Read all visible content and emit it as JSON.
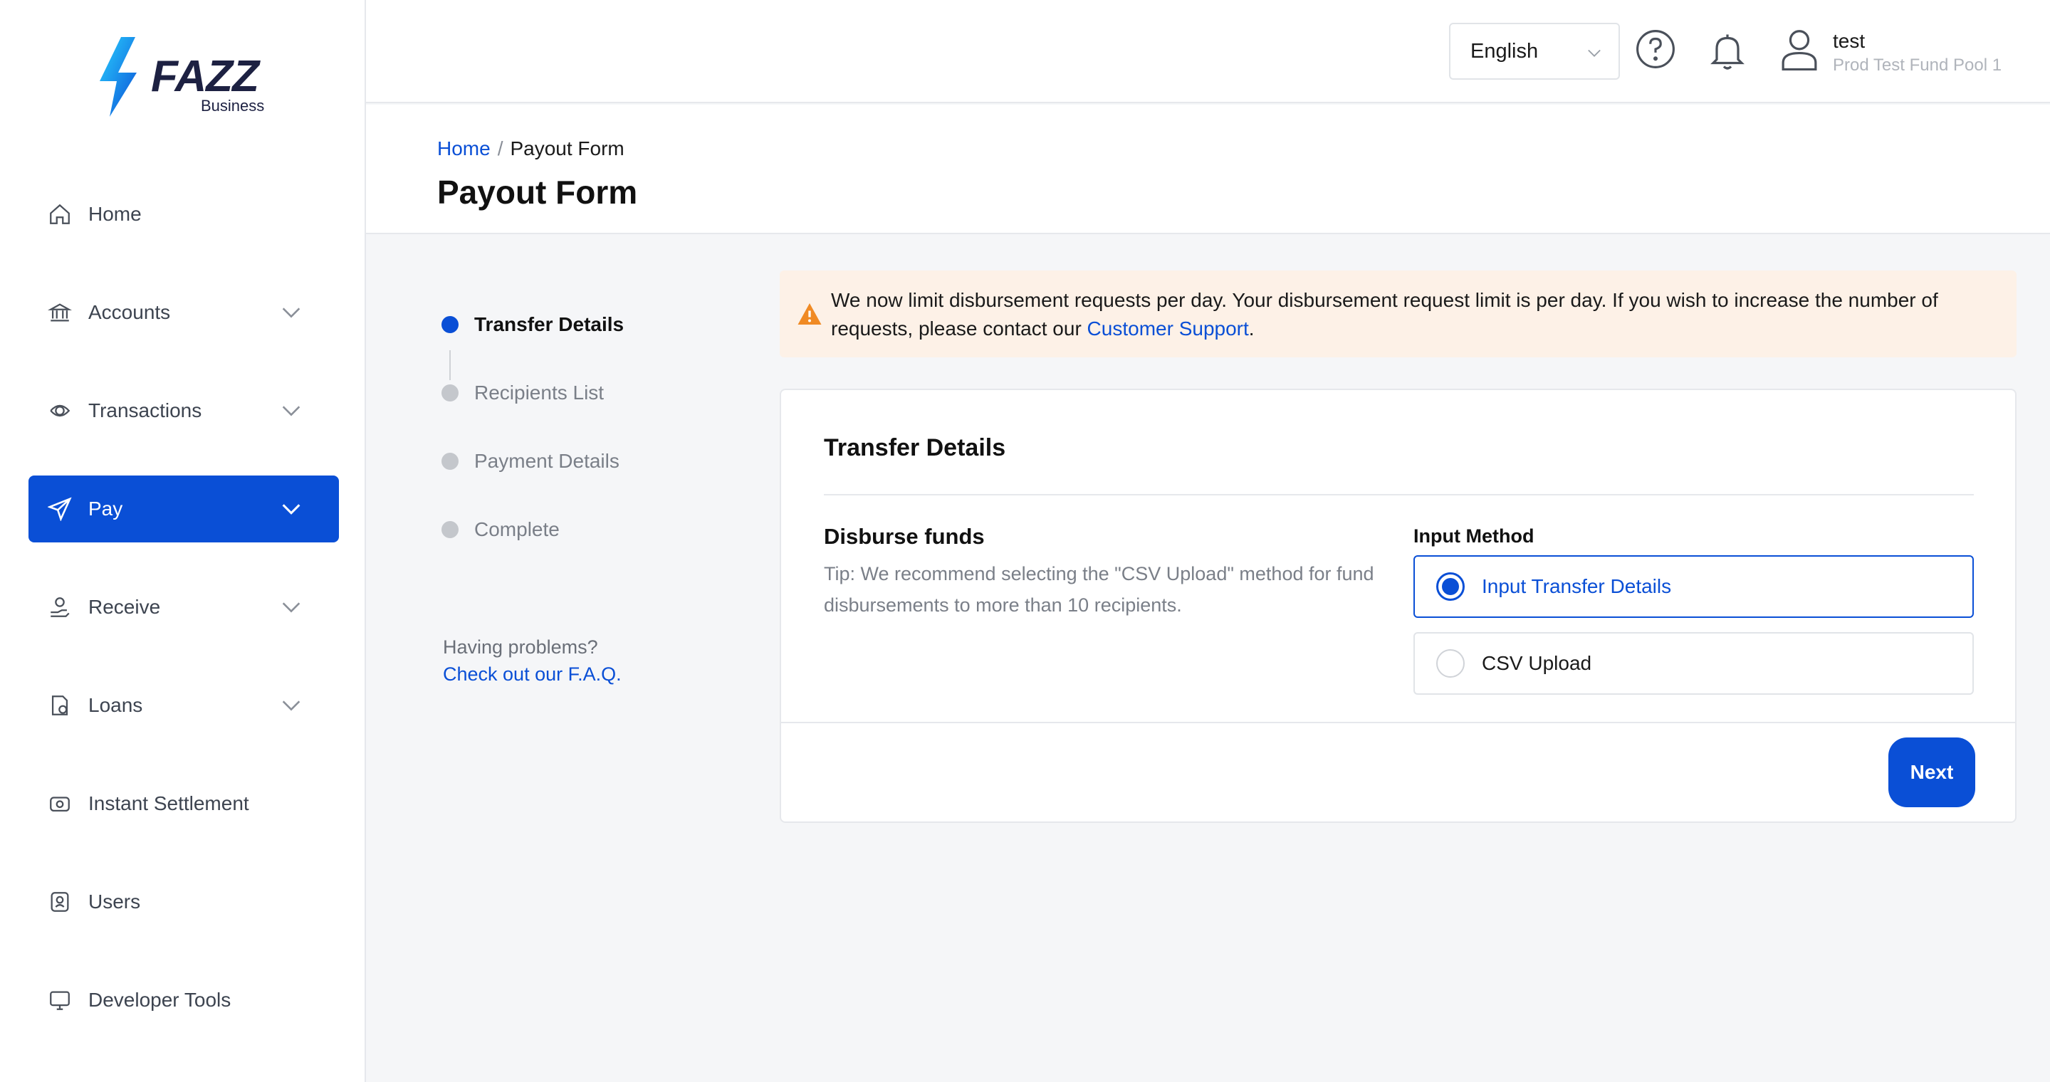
{
  "brand": {
    "name": "FAZZ",
    "sub": "Business",
    "primary": "#0a4fd6"
  },
  "sidebar": {
    "items": [
      {
        "label": "Home",
        "icon": "home-icon",
        "expandable": false
      },
      {
        "label": "Accounts",
        "icon": "bank-icon",
        "expandable": true
      },
      {
        "label": "Transactions",
        "icon": "transactions-icon",
        "expandable": true
      },
      {
        "label": "Pay",
        "icon": "send-icon",
        "expandable": true,
        "active": true
      },
      {
        "label": "Receive",
        "icon": "receive-icon",
        "expandable": true
      },
      {
        "label": "Loans",
        "icon": "loans-icon",
        "expandable": true
      },
      {
        "label": "Instant Settlement",
        "icon": "settlement-icon",
        "expandable": false
      },
      {
        "label": "Users",
        "icon": "users-icon",
        "expandable": false
      },
      {
        "label": "Developer Tools",
        "icon": "monitor-icon",
        "expandable": false
      }
    ]
  },
  "header": {
    "language": "English",
    "user": {
      "name": "test",
      "pool": "Prod Test Fund Pool 1"
    }
  },
  "page": {
    "breadcrumb": {
      "home": "Home",
      "separator": "/",
      "current": "Payout Form"
    },
    "title": "Payout Form"
  },
  "stepper": {
    "steps": [
      "Transfer Details",
      "Recipients List",
      "Payment Details",
      "Complete"
    ],
    "active_index": 0,
    "help_question": "Having problems?",
    "help_link": "Check out our F.A.Q."
  },
  "alert": {
    "text": "We now limit disbursement requests per day. Your disbursement request limit is per day. If you wish to increase the number of requests, please contact our ",
    "link": "Customer Support",
    "suffix": ".",
    "color": "#f08a24"
  },
  "card": {
    "title": "Transfer Details",
    "section_title": "Disburse funds",
    "section_tip": "Tip: We recommend selecting the \"CSV Upload\" method for fund disbursements to more than 10 recipients.",
    "input_method_label": "Input Method",
    "options": [
      "Input Transfer Details",
      "CSV Upload"
    ],
    "selected_option": 0,
    "next_label": "Next"
  }
}
